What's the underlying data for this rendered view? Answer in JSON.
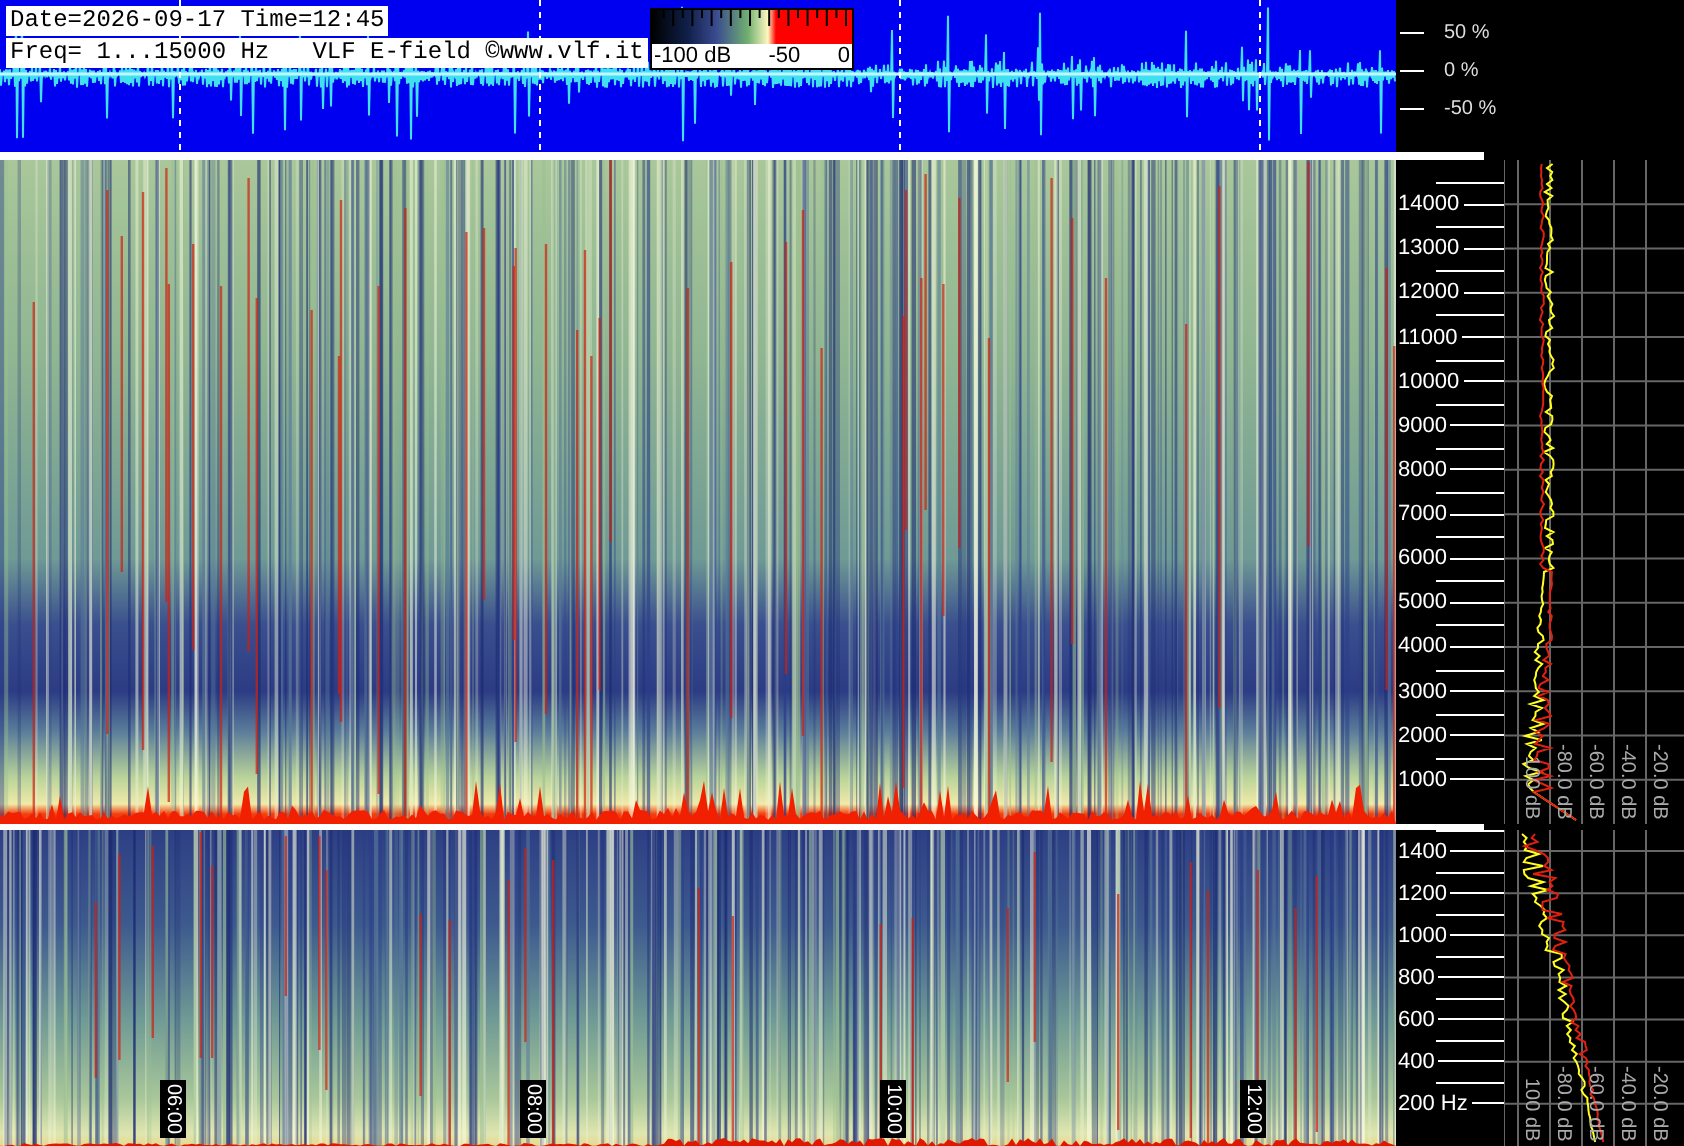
{
  "header": {
    "date_line": "Date=2026-09-17 Time=12:45",
    "freq_line": "Freq= 1...15000 Hz   VLF E-field ©www.vlf.it"
  },
  "color_scale": {
    "labels": [
      "-100 dB",
      "-50",
      "0"
    ]
  },
  "waveform_axis": {
    "labels": [
      "50 %",
      "0 %",
      "-50 %"
    ]
  },
  "upper_panel": {
    "freq_labels": [
      "14000",
      "13000",
      "12000",
      "11000",
      "10000",
      "9000",
      "8000",
      "7000",
      "6000",
      "5000",
      "4000",
      "3000",
      "2000",
      "1000"
    ],
    "db_labels": [
      "100 dB",
      "-80.0 dB",
      "-60.0 dB",
      "-40.0 dB",
      "-20.0 dB"
    ]
  },
  "lower_panel": {
    "freq_labels": [
      "1400",
      "1200",
      "1000",
      "800",
      "600",
      "400",
      "200 Hz"
    ],
    "db_labels": [
      "100 dB",
      "-80.0 dB",
      "-60.0 dB",
      "-40.0 dB",
      "-20.0 dB"
    ]
  },
  "time_labels": [
    "06:00",
    "08:00",
    "10:00",
    "12:00"
  ]
}
